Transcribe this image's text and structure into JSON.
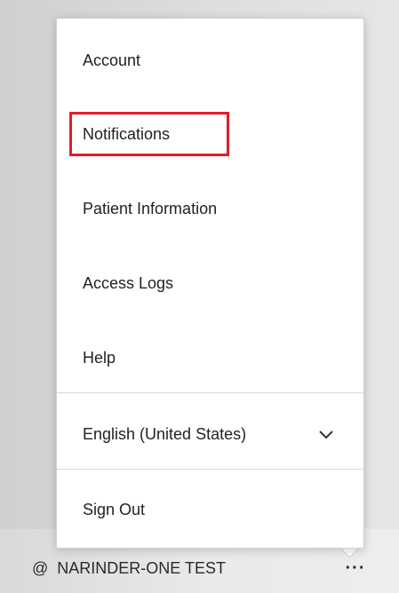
{
  "menu": {
    "items": [
      {
        "label": "Account"
      },
      {
        "label": "Notifications"
      },
      {
        "label": "Patient Information"
      },
      {
        "label": "Access Logs"
      },
      {
        "label": "Help"
      }
    ],
    "language": {
      "label": "English (United States)",
      "icon": "chevron-down-icon"
    },
    "sign_out": {
      "label": "Sign Out"
    }
  },
  "user": {
    "name": "NARINDER-ONE TEST",
    "icon": "@",
    "more_label": "···"
  },
  "colors": {
    "highlight": "#e21d2b"
  }
}
